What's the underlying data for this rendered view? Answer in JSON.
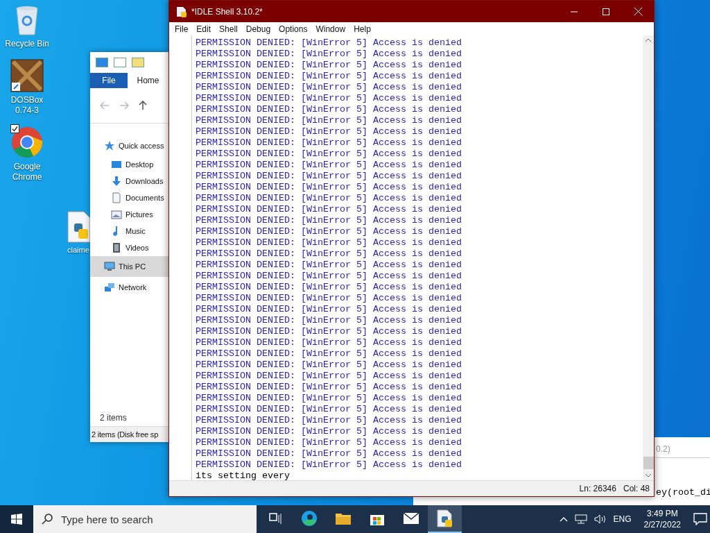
{
  "desktop_icons": [
    {
      "kind": "recycle",
      "label_lines": [
        "Recycle Bin"
      ],
      "selected": false
    },
    {
      "kind": "dosbox",
      "label_lines": [
        "DOSBox",
        "0.74-3"
      ],
      "selected": false
    },
    {
      "kind": "chrome",
      "label_lines": [
        "Google",
        "Chrome"
      ],
      "selected": true
    }
  ],
  "hidden_icon": {
    "kind": "python-file",
    "label": "claime"
  },
  "back_window": {
    "fragment": "0.2)",
    "code_line": "ey(root_di"
  },
  "explorer": {
    "ribbon_tabs": [
      {
        "label": "File",
        "selected": true
      },
      {
        "label": "Home",
        "selected": false
      }
    ],
    "nav_items": [
      {
        "label": "Quick access",
        "kind": "star",
        "selected": false,
        "children": [
          {
            "label": "Desktop",
            "kind": "desktop",
            "selected": false
          },
          {
            "label": "Downloads",
            "kind": "download",
            "selected": false
          },
          {
            "label": "Documents",
            "kind": "document",
            "selected": false
          },
          {
            "label": "Pictures",
            "kind": "pictures",
            "selected": false
          },
          {
            "label": "Music",
            "kind": "music",
            "selected": false
          },
          {
            "label": "Videos",
            "kind": "videos",
            "selected": false
          }
        ]
      },
      {
        "label": "This PC",
        "kind": "pc",
        "selected": true
      },
      {
        "label": "Network",
        "kind": "network",
        "selected": false
      }
    ],
    "item_count": "2 items",
    "status": "2 items (Disk free sp"
  },
  "idle": {
    "title": "*IDLE Shell 3.10.2*",
    "menus": [
      "File",
      "Edit",
      "Shell",
      "Debug",
      "Options",
      "Window",
      "Help"
    ],
    "lines": [
      {
        "kind": "error",
        "text": "PERMISSION DENIED: [WinError 5] Access is denied"
      },
      {
        "kind": "error",
        "text": "PERMISSION DENIED: [WinError 5] Access is denied"
      },
      {
        "kind": "error",
        "text": "PERMISSION DENIED: [WinError 5] Access is denied"
      },
      {
        "kind": "error",
        "text": "PERMISSION DENIED: [WinError 5] Access is denied"
      },
      {
        "kind": "error",
        "text": "PERMISSION DENIED: [WinError 5] Access is denied"
      },
      {
        "kind": "error",
        "text": "PERMISSION DENIED: [WinError 5] Access is denied"
      },
      {
        "kind": "error",
        "text": "PERMISSION DENIED: [WinError 5] Access is denied"
      },
      {
        "kind": "error",
        "text": "PERMISSION DENIED: [WinError 5] Access is denied"
      },
      {
        "kind": "error",
        "text": "PERMISSION DENIED: [WinError 5] Access is denied"
      },
      {
        "kind": "error",
        "text": "PERMISSION DENIED: [WinError 5] Access is denied"
      },
      {
        "kind": "error",
        "text": "PERMISSION DENIED: [WinError 5] Access is denied"
      },
      {
        "kind": "error",
        "text": "PERMISSION DENIED: [WinError 5] Access is denied"
      },
      {
        "kind": "error",
        "text": "PERMISSION DENIED: [WinError 5] Access is denied"
      },
      {
        "kind": "error",
        "text": "PERMISSION DENIED: [WinError 5] Access is denied"
      },
      {
        "kind": "error",
        "text": "PERMISSION DENIED: [WinError 5] Access is denied"
      },
      {
        "kind": "error",
        "text": "PERMISSION DENIED: [WinError 5] Access is denied"
      },
      {
        "kind": "error",
        "text": "PERMISSION DENIED: [WinError 5] Access is denied"
      },
      {
        "kind": "error",
        "text": "PERMISSION DENIED: [WinError 5] Access is denied"
      },
      {
        "kind": "error",
        "text": "PERMISSION DENIED: [WinError 5] Access is denied"
      },
      {
        "kind": "error",
        "text": "PERMISSION DENIED: [WinError 5] Access is denied"
      },
      {
        "kind": "error",
        "text": "PERMISSION DENIED: [WinError 5] Access is denied"
      },
      {
        "kind": "error",
        "text": "PERMISSION DENIED: [WinError 5] Access is denied"
      },
      {
        "kind": "error",
        "text": "PERMISSION DENIED: [WinError 5] Access is denied"
      },
      {
        "kind": "error",
        "text": "PERMISSION DENIED: [WinError 5] Access is denied"
      },
      {
        "kind": "error",
        "text": "PERMISSION DENIED: [WinError 5] Access is denied"
      },
      {
        "kind": "error",
        "text": "PERMISSION DENIED: [WinError 5] Access is denied"
      },
      {
        "kind": "error",
        "text": "PERMISSION DENIED: [WinError 5] Access is denied"
      },
      {
        "kind": "error",
        "text": "PERMISSION DENIED: [WinError 5] Access is denied"
      },
      {
        "kind": "error",
        "text": "PERMISSION DENIED: [WinError 5] Access is denied"
      },
      {
        "kind": "error",
        "text": "PERMISSION DENIED: [WinError 5] Access is denied"
      },
      {
        "kind": "error",
        "text": "PERMISSION DENIED: [WinError 5] Access is denied"
      },
      {
        "kind": "error",
        "text": "PERMISSION DENIED: [WinError 5] Access is denied"
      },
      {
        "kind": "error",
        "text": "PERMISSION DENIED: [WinError 5] Access is denied"
      },
      {
        "kind": "error",
        "text": "PERMISSION DENIED: [WinError 5] Access is denied"
      },
      {
        "kind": "error",
        "text": "PERMISSION DENIED: [WinError 5] Access is denied"
      },
      {
        "kind": "error",
        "text": "PERMISSION DENIED: [WinError 5] Access is denied"
      },
      {
        "kind": "error",
        "text": "PERMISSION DENIED: [WinError 5] Access is denied"
      },
      {
        "kind": "error",
        "text": "PERMISSION DENIED: [WinError 5] Access is denied"
      },
      {
        "kind": "error",
        "text": "PERMISSION DENIED: [WinError 5] Access is denied"
      },
      {
        "kind": "input",
        "text": "its setting every"
      }
    ],
    "status": {
      "line": "Ln: 26346",
      "col": "Col: 48"
    }
  },
  "taskbar": {
    "search_placeholder": "Type here to search",
    "apps": [
      {
        "kind": "task-view",
        "selected": false
      },
      {
        "kind": "edge",
        "selected": false
      },
      {
        "kind": "folder",
        "selected": false
      },
      {
        "kind": "store",
        "selected": false
      },
      {
        "kind": "mail",
        "selected": false
      },
      {
        "kind": "python",
        "selected": true
      }
    ],
    "language": "ENG",
    "time": "3:49 PM",
    "date": "2/27/2022"
  }
}
